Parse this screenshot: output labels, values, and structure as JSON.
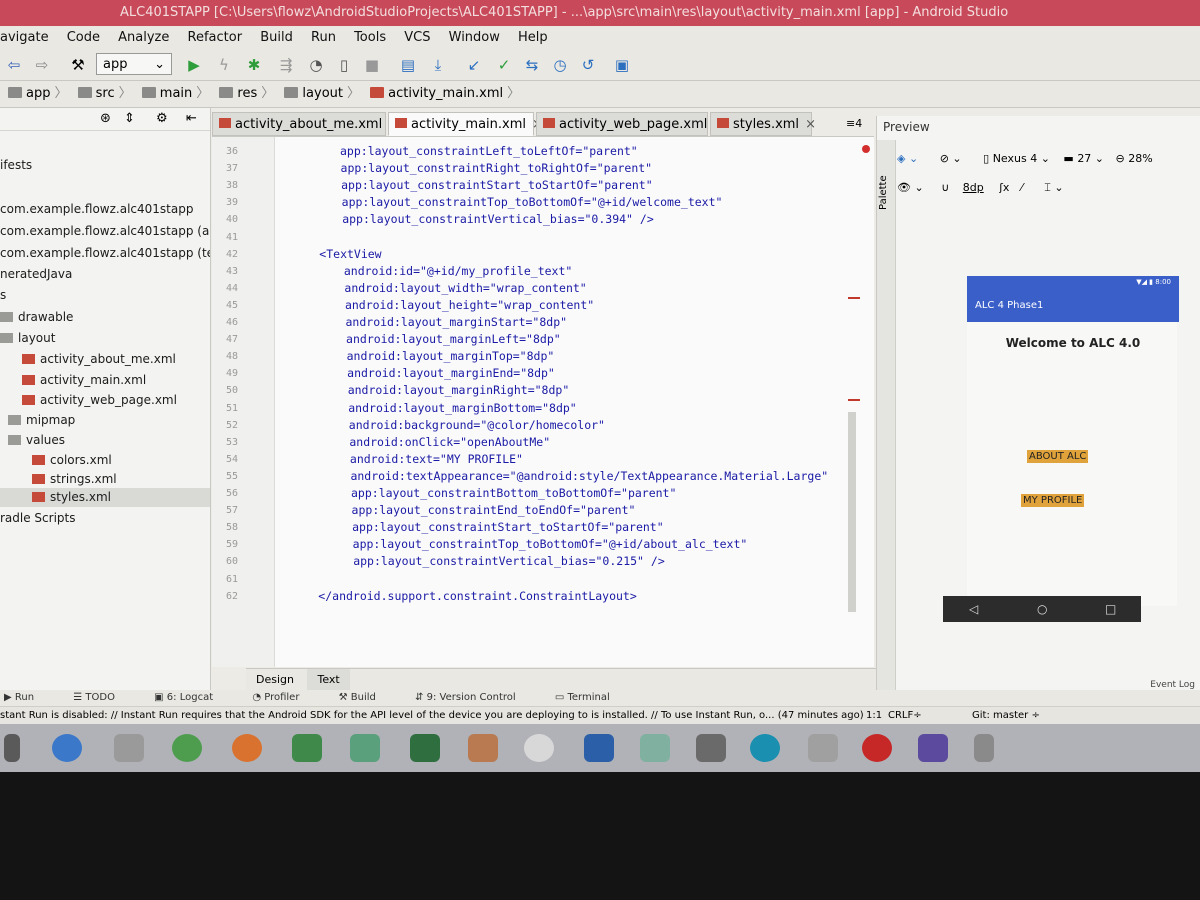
{
  "window": {
    "title": "ALC401STAPP [C:\\Users\\flowz\\AndroidStudioProjects\\ALC401STAPP] - ...\\app\\src\\main\\res\\layout\\activity_main.xml [app] - Android Studio"
  },
  "menu": [
    "avigate",
    "Code",
    "Analyze",
    "Refactor",
    "Build",
    "Run",
    "Tools",
    "VCS",
    "Window",
    "Help"
  ],
  "toolbar": {
    "run_config": "app"
  },
  "breadcrumb": [
    "app",
    "src",
    "main",
    "res",
    "layout",
    "activity_main.xml"
  ],
  "project_tree": [
    {
      "label": "ifests",
      "icon": "folder"
    },
    {
      "label": "com.example.flowz.alc401stapp",
      "icon": "folder"
    },
    {
      "label": "com.example.flowz.alc401stapp (andr",
      "icon": "folder"
    },
    {
      "label": "com.example.flowz.alc401stapp (test)",
      "icon": "folder"
    },
    {
      "label": "neratedJava",
      "icon": "folder"
    },
    {
      "label": "s",
      "icon": "folder"
    },
    {
      "label": "drawable",
      "icon": "folder"
    },
    {
      "label": "layout",
      "icon": "folder"
    },
    {
      "label": "activity_about_me.xml",
      "icon": "xml"
    },
    {
      "label": "activity_main.xml",
      "icon": "xml"
    },
    {
      "label": "activity_web_page.xml",
      "icon": "xml"
    },
    {
      "label": "mipmap",
      "icon": "folder"
    },
    {
      "label": "values",
      "icon": "folder"
    },
    {
      "label": "colors.xml",
      "icon": "xml"
    },
    {
      "label": "strings.xml",
      "icon": "xml"
    },
    {
      "label": "styles.xml",
      "icon": "xml"
    },
    {
      "label": "radle Scripts",
      "icon": "folder"
    }
  ],
  "editor_tabs": [
    {
      "label": "activity_about_me.xml",
      "close": "×"
    },
    {
      "label": "activity_main.xml",
      "close": "×"
    },
    {
      "label": "activity_web_page.xml",
      "close": "×"
    },
    {
      "label": "styles.xml",
      "close": "×"
    }
  ],
  "tab_overflow": "≡4",
  "code_lines": [
    {
      "n": "36",
      "text": "app:layout_constraintLeft_toLeftOf=\"parent\""
    },
    {
      "n": "37",
      "text": "app:layout_constraintRight_toRightOf=\"parent\""
    },
    {
      "n": "38",
      "text": "app:layout_constraintStart_toStartOf=\"parent\""
    },
    {
      "n": "39",
      "text": "app:layout_constraintTop_toBottomOf=\"@+id/welcome_text\""
    },
    {
      "n": "40",
      "text": "app:layout_constraintVertical_bias=\"0.394\" />"
    },
    {
      "n": "41",
      "text": ""
    },
    {
      "n": "42",
      "text": "<TextView"
    },
    {
      "n": "43",
      "text": "android:id=\"@+id/my_profile_text\""
    },
    {
      "n": "44",
      "text": "android:layout_width=\"wrap_content\""
    },
    {
      "n": "45",
      "text": "android:layout_height=\"wrap_content\""
    },
    {
      "n": "46",
      "text": "android:layout_marginStart=\"8dp\""
    },
    {
      "n": "47",
      "text": "android:layout_marginLeft=\"8dp\""
    },
    {
      "n": "48",
      "text": "android:layout_marginTop=\"8dp\""
    },
    {
      "n": "49",
      "text": "android:layout_marginEnd=\"8dp\""
    },
    {
      "n": "50",
      "text": "android:layout_marginRight=\"8dp\""
    },
    {
      "n": "51",
      "text": "android:layout_marginBottom=\"8dp\""
    },
    {
      "n": "52",
      "text": "android:background=\"@color/homecolor\""
    },
    {
      "n": "53",
      "text": "android:onClick=\"openAboutMe\""
    },
    {
      "n": "54",
      "text": "android:text=\"MY PROFILE\""
    },
    {
      "n": "55",
      "text": "android:textAppearance=\"@android:style/TextAppearance.Material.Large\""
    },
    {
      "n": "56",
      "text": "app:layout_constraintBottom_toBottomOf=\"parent\""
    },
    {
      "n": "57",
      "text": "app:layout_constraintEnd_toEndOf=\"parent\""
    },
    {
      "n": "58",
      "text": "app:layout_constraintStart_toStartOf=\"parent\""
    },
    {
      "n": "59",
      "text": "app:layout_constraintTop_toBottomOf=\"@+id/about_alc_text\""
    },
    {
      "n": "60",
      "text": "app:layout_constraintVertical_bias=\"0.215\" />"
    },
    {
      "n": "61",
      "text": ""
    },
    {
      "n": "62",
      "text": "</android.support.constraint.ConstraintLayout>"
    }
  ],
  "editor_bottom_tabs": [
    "Design",
    "Text"
  ],
  "preview": {
    "header": "Preview",
    "palette_label": "Palette",
    "device": "Nexus 4",
    "api": "27",
    "zoom": "28%",
    "margin": "8dp",
    "app_title": "ALC 4 Phase1",
    "status_time": "8:00",
    "welcome": "Welcome to ALC 4.0",
    "about_btn": "ABOUT ALC",
    "profile_btn": "MY PROFILE",
    "nav_back": "◁",
    "nav_home": "○",
    "nav_recent": "□"
  },
  "tool_windows": [
    "Run",
    "TODO",
    "6: Logcat",
    "Profiler",
    "Build",
    "9: Version Control",
    "Terminal"
  ],
  "event_log": "Event Log",
  "status": {
    "message": "stant Run is disabled: // Instant Run requires that the Android SDK for the API level of the device you are deploying to is installed. // To use Instant Run, o... (47 minutes ago)",
    "position": "1:1",
    "line_sep": "CRLF÷",
    "git": "Git: master ÷"
  }
}
